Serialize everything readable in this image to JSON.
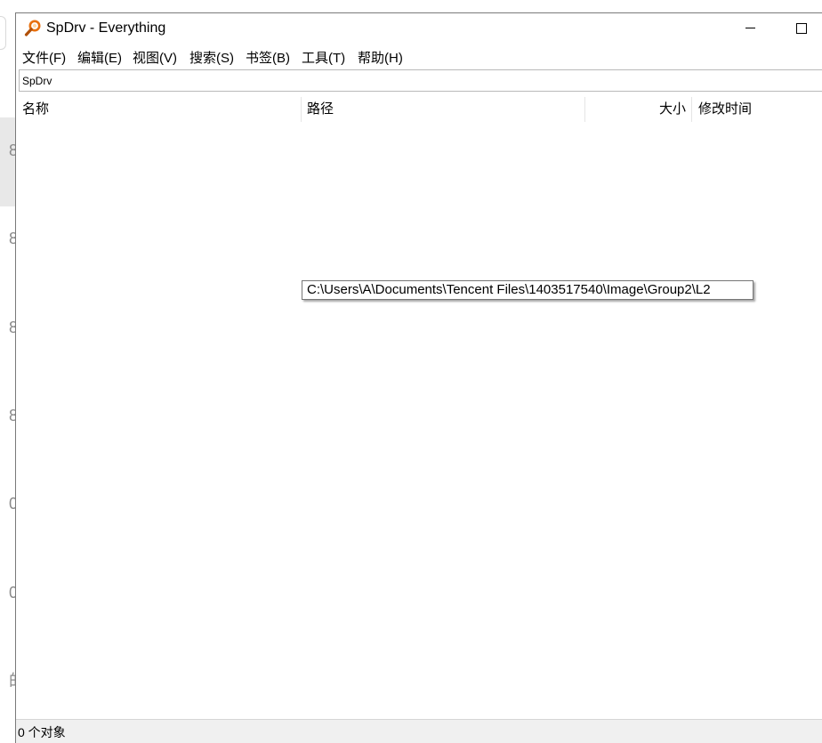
{
  "background": {
    "glyphs": [
      "8",
      "8",
      "8",
      "8",
      "0",
      "0",
      "的"
    ]
  },
  "window": {
    "title": "SpDrv - Everything",
    "icon": "magnifier-icon",
    "accent": "#e8700e"
  },
  "menu": {
    "items": [
      {
        "label": "文件(F)"
      },
      {
        "label": "编辑(E)"
      },
      {
        "label": "视图(V)"
      },
      {
        "label": "搜索(S)"
      },
      {
        "label": "书签(B)"
      },
      {
        "label": "工具(T)"
      },
      {
        "label": "帮助(H)"
      }
    ]
  },
  "search": {
    "value": "SpDrv"
  },
  "columns": {
    "name": "名称",
    "path": "路径",
    "size": "大小",
    "modified": "修改时间"
  },
  "tooltip": {
    "text": "C:\\Users\\A\\Documents\\Tencent Files\\1403517540\\Image\\Group2\\L2"
  },
  "status": {
    "text": "0 个对象"
  }
}
